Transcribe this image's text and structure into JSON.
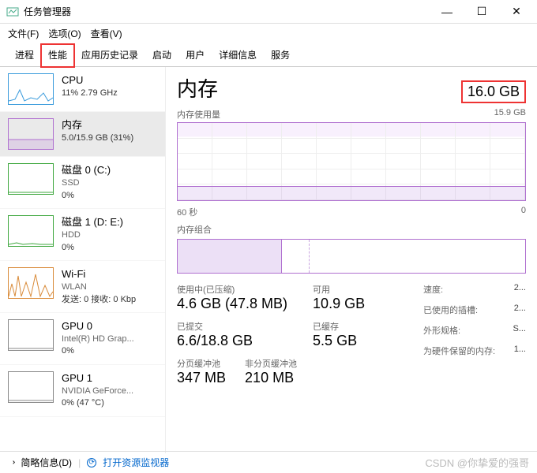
{
  "window": {
    "title": "任务管理器"
  },
  "menu": {
    "file": "文件(F)",
    "options": "选项(O)",
    "view": "查看(V)"
  },
  "tabs": [
    "进程",
    "性能",
    "应用历史记录",
    "启动",
    "用户",
    "详细信息",
    "服务"
  ],
  "sidebar": {
    "cpu": {
      "title": "CPU",
      "sub": "11% 2.79 GHz"
    },
    "mem": {
      "title": "内存",
      "sub": "5.0/15.9 GB (31%)"
    },
    "disk0": {
      "title": "磁盘 0 (C:)",
      "line1": "SSD",
      "line2": "0%"
    },
    "disk1": {
      "title": "磁盘 1 (D: E:)",
      "line1": "HDD",
      "line2": "0%"
    },
    "wifi": {
      "title": "Wi-Fi",
      "line1": "WLAN",
      "line2": "发送: 0 接收: 0 Kbp"
    },
    "gpu0": {
      "title": "GPU 0",
      "line1": "Intel(R) HD Grap...",
      "line2": "0%"
    },
    "gpu1": {
      "title": "GPU 1",
      "line1": "NVIDIA GeForce...",
      "line2": "0% (47 °C)"
    }
  },
  "main": {
    "title": "内存",
    "total": "16.0 GB",
    "usage_label": "内存使用量",
    "usage_max": "15.9 GB",
    "axis_left": "60 秒",
    "axis_right": "0",
    "composition_label": "内存组合",
    "stats": {
      "inuse": {
        "l": "使用中(已压缩)",
        "v": "4.6 GB (47.8 MB)"
      },
      "available": {
        "l": "可用",
        "v": "10.9 GB"
      },
      "committed": {
        "l": "已提交",
        "v": "6.6/18.8 GB"
      },
      "cached": {
        "l": "已缓存",
        "v": "5.5 GB"
      },
      "paged": {
        "l": "分页缓冲池",
        "v": "347 MB"
      },
      "nonpaged": {
        "l": "非分页缓冲池",
        "v": "210 MB"
      }
    },
    "kv": {
      "speed": {
        "k": "速度:",
        "v": "2..."
      },
      "slots": {
        "k": "已使用的插槽:",
        "v": "2..."
      },
      "form": {
        "k": "外形规格:",
        "v": "S..."
      },
      "reserved": {
        "k": "为硬件保留的内存:",
        "v": "1..."
      }
    }
  },
  "footer": {
    "fewer": "简略信息(D)",
    "resmon": "打开资源监视器"
  },
  "watermark": "CSDN @你挚爱的强哥",
  "colors": {
    "accent": "#b070d0",
    "cpu": "#3a9bdc",
    "disk": "#3fa83f",
    "net": "#d98b3a"
  }
}
